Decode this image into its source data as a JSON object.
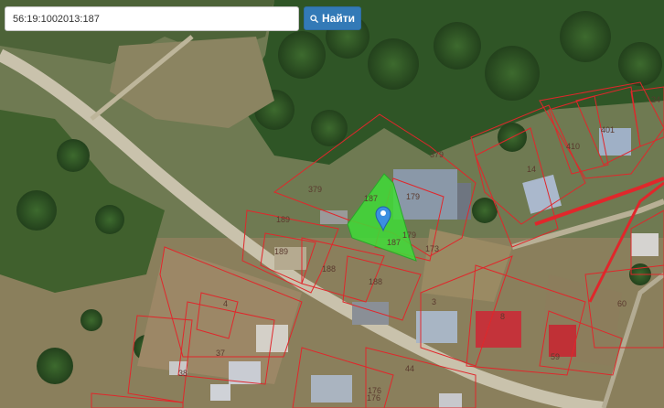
{
  "search": {
    "value": "56:19:1002013:187",
    "button_label": "Найти",
    "button_icon": "search-icon"
  },
  "map": {
    "parcel_color": "#e0272b",
    "selected_parcel_color": "#3fdc37",
    "marker_color": "#3b8fe0",
    "parcel_labels": [
      "24",
      "401",
      "410",
      "14",
      "379",
      "379",
      "179",
      "179",
      "187",
      "187",
      "173",
      "189",
      "189",
      "188",
      "188",
      "4",
      "3",
      "8",
      "37",
      "38",
      "59",
      "60",
      "44",
      "176",
      "176"
    ],
    "selected_parcel_label": "187"
  }
}
